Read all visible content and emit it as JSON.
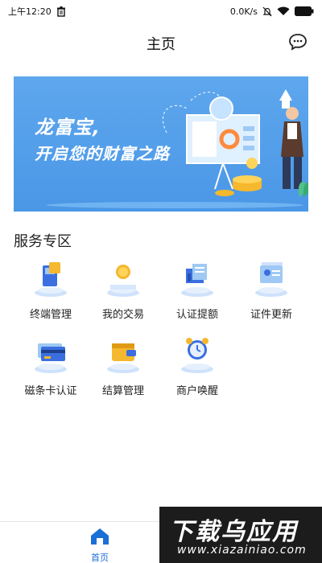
{
  "status_bar": {
    "time": "上午12:20",
    "network_speed": "0.0K/s",
    "icons": [
      "trash-icon",
      "mute-icon",
      "wifi-icon",
      "battery-icon"
    ]
  },
  "header": {
    "title": "主页",
    "chat_icon": "chat-bubble-icon"
  },
  "banner": {
    "line1": "龙富宝,",
    "line2": "开启您的财富之路"
  },
  "services": {
    "title": "服务专区",
    "items": [
      {
        "label": "终端管理",
        "icon": "terminal-icon"
      },
      {
        "label": "我的交易",
        "icon": "coin-icon"
      },
      {
        "label": "认证提额",
        "icon": "certificate-icon"
      },
      {
        "label": "证件更新",
        "icon": "id-card-icon"
      },
      {
        "label": "磁条卡认证",
        "icon": "magstripe-card-icon"
      },
      {
        "label": "结算管理",
        "icon": "wallet-icon"
      },
      {
        "label": "商户唤醒",
        "icon": "alarm-clock-icon"
      }
    ]
  },
  "bottom_nav": {
    "home_label": "首页",
    "accent_color": "#1a6fd6"
  },
  "watermark": {
    "title": "下载乌应用",
    "url": "www.xiazainiao.com"
  }
}
